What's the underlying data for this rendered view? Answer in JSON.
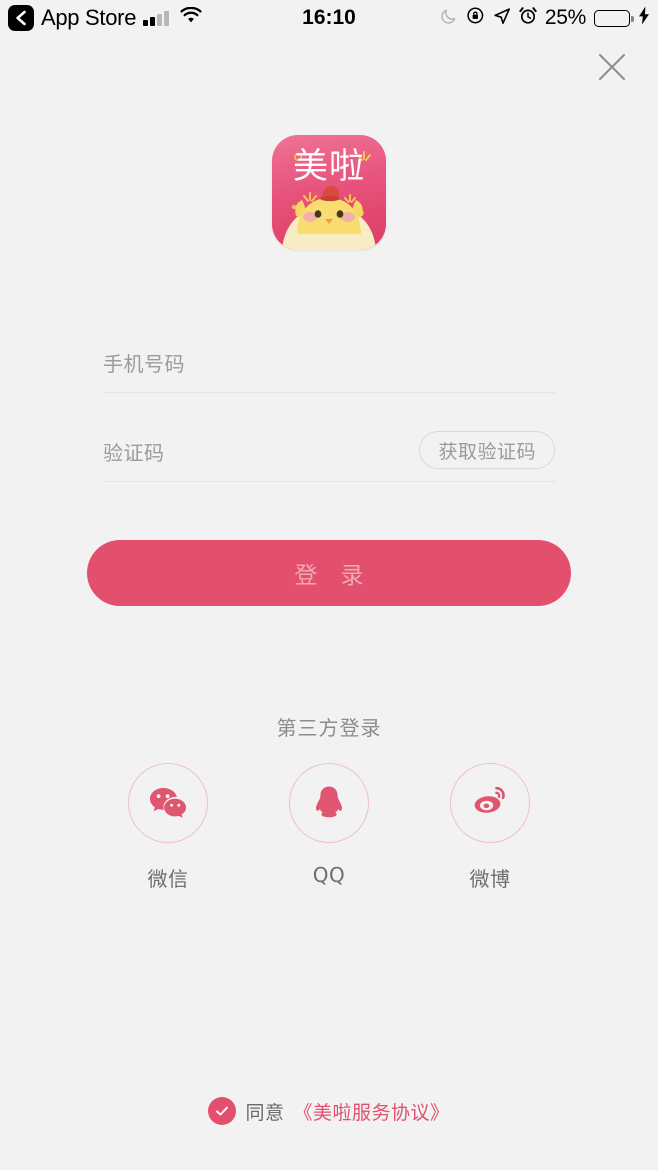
{
  "statusbar": {
    "back_label": "App Store",
    "back_icon": "chevron-left-icon",
    "signal_icon": "cellular-signal-icon",
    "wifi_icon": "wifi-icon",
    "time": "16:10",
    "moon_icon": "do-not-disturb-moon-icon",
    "rotation_lock_icon": "rotation-lock-icon",
    "location_icon": "location-arrow-icon",
    "alarm_icon": "alarm-clock-icon",
    "battery_percent": "25%",
    "battery_level": 25,
    "battery_color": "#fbcf32",
    "charging_icon": "charging-bolt-icon"
  },
  "header": {
    "close_icon": "close-icon"
  },
  "logo": {
    "app_name": "美啦",
    "icon_name": "meila-app-icon",
    "bg_top": "#ef7396",
    "bg_bottom": "#dd3d63",
    "chick_body": "#f7dc6d",
    "chick_shell": "#f6e9bd",
    "hat": "#d94a3c"
  },
  "form": {
    "phone": {
      "placeholder": "手机号码",
      "value": ""
    },
    "code": {
      "placeholder": "验证码",
      "value": "",
      "get_code_label": "获取验证码"
    },
    "login_label": "登 录",
    "login_color": "#e2506d"
  },
  "third_party": {
    "title": "第三方登录",
    "items": [
      {
        "label": "微信",
        "icon": "wechat-icon"
      },
      {
        "label": "QQ",
        "icon": "qq-icon"
      },
      {
        "label": "微博",
        "icon": "weibo-icon"
      }
    ],
    "icon_color": "#e05570",
    "circle_border": "#f0bfca"
  },
  "agreement": {
    "checked": true,
    "check_icon": "check-circle-icon",
    "text": "同意",
    "link": "《美啦服务协议》",
    "link_color": "#e2506d"
  }
}
